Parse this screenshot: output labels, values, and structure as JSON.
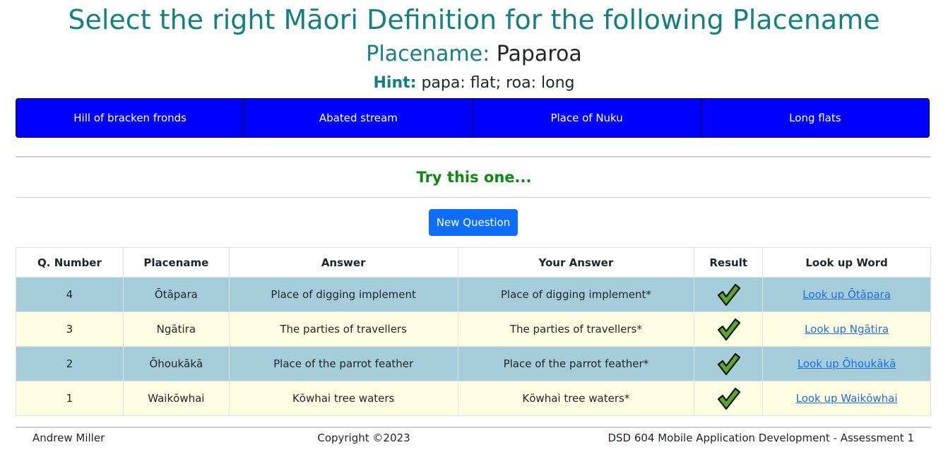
{
  "header": {
    "title": "Select the right Māori Definition for the following Placename",
    "placename_label": "Placename:",
    "placename_value": "Paparoa",
    "hint_label": "Hint:",
    "hint_text": "papa: flat; roa: long"
  },
  "choices": [
    "Hill of bracken fronds",
    "Abated stream",
    "Place of Nuku",
    "Long flats"
  ],
  "status": {
    "message": "Try this one..."
  },
  "new_question_label": "New Question",
  "table": {
    "headers": [
      "Q. Number",
      "Placename",
      "Answer",
      "Your Answer",
      "Result",
      "Look up Word"
    ],
    "rows": [
      {
        "number": "4",
        "placename": "Ōtāpara",
        "answer": "Place of digging implement",
        "your_answer": "Place of digging implement*",
        "result": "check-icon",
        "lookup": "Look up Ōtāpara"
      },
      {
        "number": "3",
        "placename": "Ngātira",
        "answer": "The parties of travellers",
        "your_answer": "The parties of travellers*",
        "result": "check-icon",
        "lookup": "Look up Ngātira"
      },
      {
        "number": "2",
        "placename": "Ōhoukākā",
        "answer": "Place of the parrot feather",
        "your_answer": "Place of the parrot feather*",
        "result": "check-icon",
        "lookup": "Look up Ōhoukākā"
      },
      {
        "number": "1",
        "placename": "Waikōwhai",
        "answer": "Kōwhai tree waters",
        "your_answer": "Kōwhai tree waters*",
        "result": "check-icon",
        "lookup": "Look up Waikōwhai"
      }
    ]
  },
  "footer": {
    "author": "Andrew Miller",
    "copyright": "Copyright ©2023",
    "course": "DSD 604 Mobile Application Development - Assessment 1"
  },
  "colors": {
    "accent_teal": "#14807f",
    "choice_blue": "#0000ff",
    "button_blue": "#0d6efd",
    "success_green": "#0e8a12",
    "row_blue": "#a4cdd9",
    "row_yellow": "#fefde2"
  }
}
